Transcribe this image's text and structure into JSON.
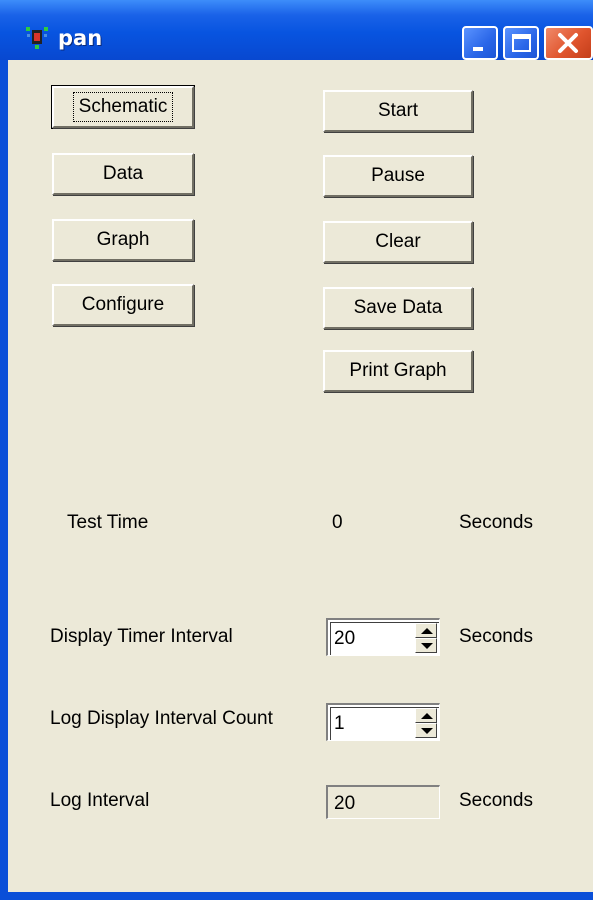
{
  "window": {
    "title": "pan",
    "icon": "app-icon",
    "controls": {
      "minimize": "minimize-icon",
      "maximize": "maximize-icon",
      "close": "close-icon"
    }
  },
  "left_buttons": [
    "Schematic",
    "Data",
    "Graph",
    "Configure"
  ],
  "right_buttons": [
    "Start",
    "Pause",
    "Clear",
    "Save Data",
    "Print Graph"
  ],
  "test_time": {
    "label": "Test Time",
    "value": "0",
    "unit": "Seconds"
  },
  "display_timer": {
    "label": "Display Timer Interval",
    "value": "20",
    "unit": "Seconds"
  },
  "log_display_count": {
    "label": "Log Display Interval Count",
    "value": "1"
  },
  "log_interval": {
    "label": "Log Interval",
    "value": "20",
    "unit": "Seconds"
  },
  "colors": {
    "face": "#ece9d8",
    "title_blue": "#0854e0",
    "close_red": "#e0552e"
  }
}
